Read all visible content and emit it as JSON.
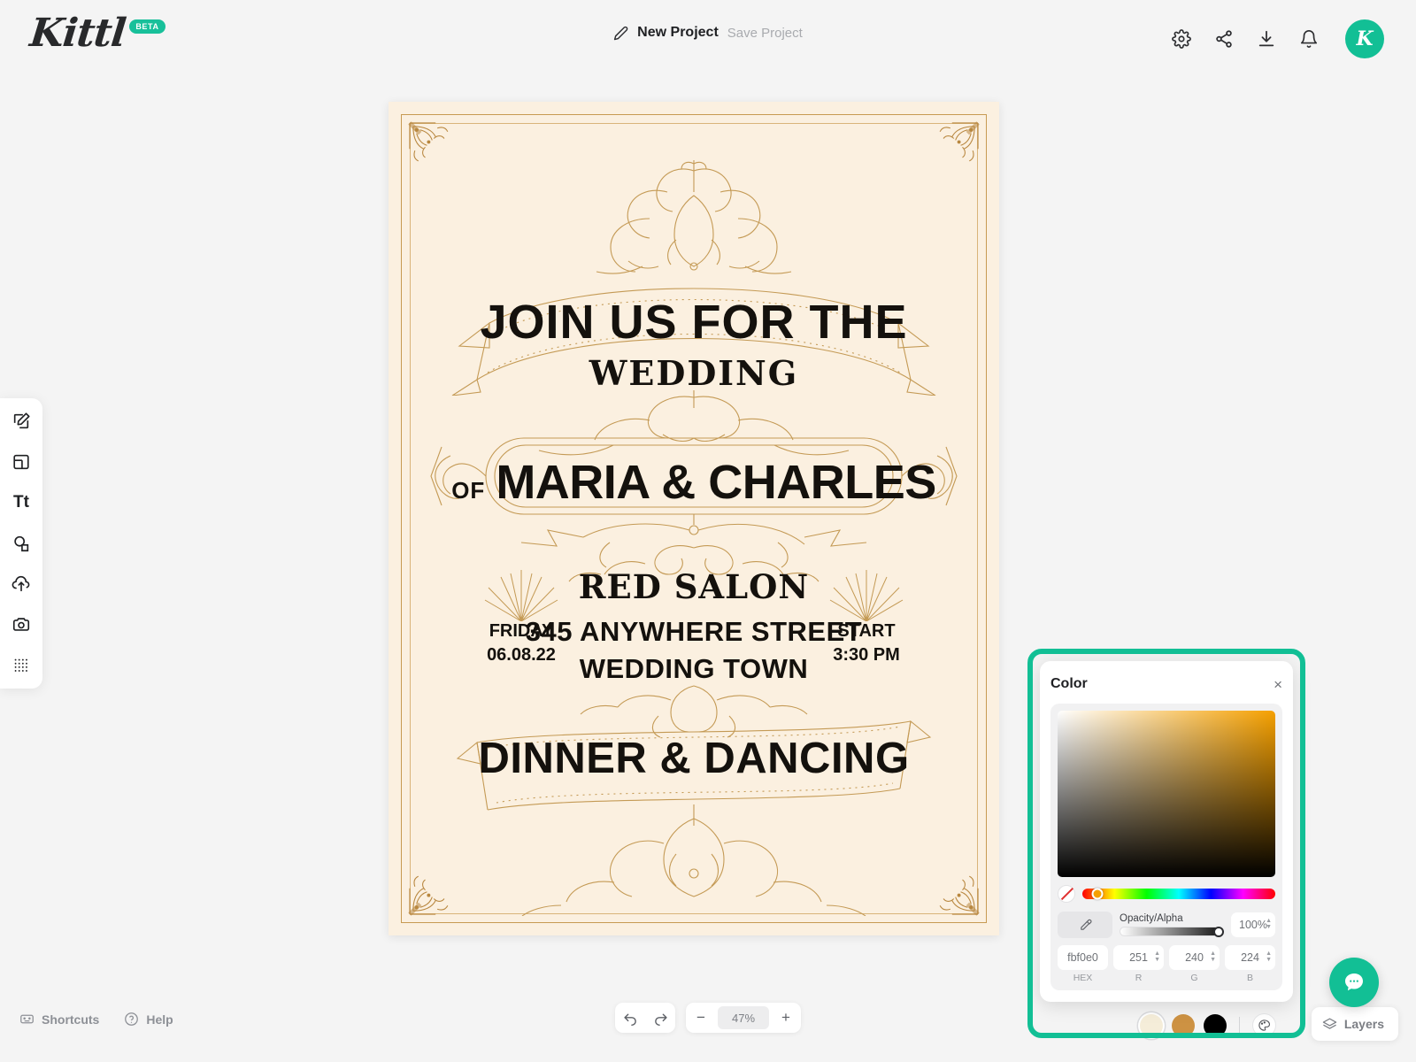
{
  "app": {
    "logo_text": "Kittl",
    "beta_label": "BETA",
    "accent_color": "#12bf95"
  },
  "header": {
    "project_name": "New Project",
    "save_label": "Save Project",
    "edit_icon": "pencil-icon",
    "icons": [
      {
        "name": "settings-icon",
        "label": "Settings"
      },
      {
        "name": "share-icon",
        "label": "Share"
      },
      {
        "name": "download-icon",
        "label": "Download"
      },
      {
        "name": "notifications-icon",
        "label": "Notifications"
      }
    ],
    "avatar_initial": "K"
  },
  "left_toolbar": {
    "items": [
      {
        "name": "design-icon",
        "label": "Design"
      },
      {
        "name": "templates-icon",
        "label": "Templates"
      },
      {
        "name": "text-icon",
        "label": "Tt"
      },
      {
        "name": "elements-icon",
        "label": "Elements"
      },
      {
        "name": "uploads-icon",
        "label": "Uploads"
      },
      {
        "name": "photos-icon",
        "label": "Photos"
      },
      {
        "name": "patterns-icon",
        "label": "Patterns"
      }
    ]
  },
  "canvas": {
    "background_color": "#fbf0e0",
    "ink_color": "#14110d",
    "ornament_color": "#c49a55",
    "text": {
      "line_join": "JOIN US FOR THE",
      "line_wedding": "WEDDING",
      "of": "OF",
      "names": "MARIA & CHARLES",
      "venue": "RED SALON",
      "address_1": "345 ANYWHERE STREET",
      "address_2": "WEDDING TOWN",
      "day": "FRIDAY",
      "date": "06.08.22",
      "start_label": "START",
      "start_time": "3:30 PM",
      "footer": "DINNER & DANCING"
    }
  },
  "bottom_bar": {
    "shortcuts_label": "Shortcuts",
    "help_label": "Help",
    "undo_icon": "undo-arrow-icon",
    "redo_icon": "redo-arrow-icon",
    "zoom_out": "−",
    "zoom_in": "+",
    "zoom_value": "47%"
  },
  "color_panel": {
    "title": "Color",
    "close_label": "×",
    "hue_color": "#f5a000",
    "opacity_label": "Opacity/Alpha",
    "opacity_value": "100%",
    "fields": [
      {
        "label": "HEX",
        "value": "fbf0e0"
      },
      {
        "label": "R",
        "value": "251"
      },
      {
        "label": "G",
        "value": "240"
      },
      {
        "label": "B",
        "value": "224"
      }
    ],
    "eyedropper_icon": "eyedropper-icon"
  },
  "swatches": {
    "items": [
      {
        "name": "swatch-cream",
        "color": "#f5edd9",
        "selected": true
      },
      {
        "name": "swatch-gold",
        "color": "#cd9243",
        "selected": false
      },
      {
        "name": "swatch-black",
        "color": "#000000",
        "selected": false
      }
    ],
    "palette_icon": "palette-icon"
  },
  "layers": {
    "label": "Layers",
    "icon": "layers-icon"
  },
  "chat": {
    "icon": "chat-bubble-icon"
  }
}
